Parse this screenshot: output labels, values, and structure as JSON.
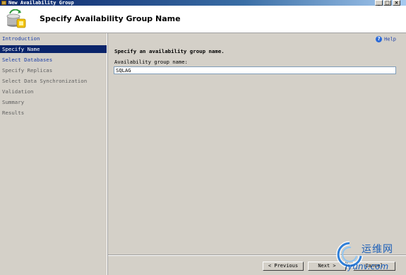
{
  "window": {
    "title": "New Availability Group",
    "buttons": {
      "minimize": "_",
      "maximize": "□",
      "close": "×"
    }
  },
  "header": {
    "title": "Specify Availability Group Name"
  },
  "nav": {
    "items": [
      {
        "label": "Introduction",
        "state": "link"
      },
      {
        "label": "Specify Name",
        "state": "selected"
      },
      {
        "label": "Select Databases",
        "state": "link"
      },
      {
        "label": "Specify Replicas",
        "state": "disabled"
      },
      {
        "label": "Select Data Synchronization",
        "state": "disabled"
      },
      {
        "label": "Validation",
        "state": "disabled"
      },
      {
        "label": "Summary",
        "state": "disabled"
      },
      {
        "label": "Results",
        "state": "disabled"
      }
    ]
  },
  "main": {
    "help_label": "Help",
    "instruction": "Specify an availability group name.",
    "field_label": "Availability group name:",
    "group_name_value": "SQLAG"
  },
  "footer": {
    "previous_label": "< Previous",
    "next_label": "Next >",
    "cancel_label": "Cancel"
  },
  "watermark": {
    "top_text": "运维网",
    "bottom_text": "iyunv.com"
  },
  "colors": {
    "selection": "#0a246a",
    "link": "#1c3fa8",
    "disabled_text": "#606060",
    "face": "#d4d0c8"
  }
}
